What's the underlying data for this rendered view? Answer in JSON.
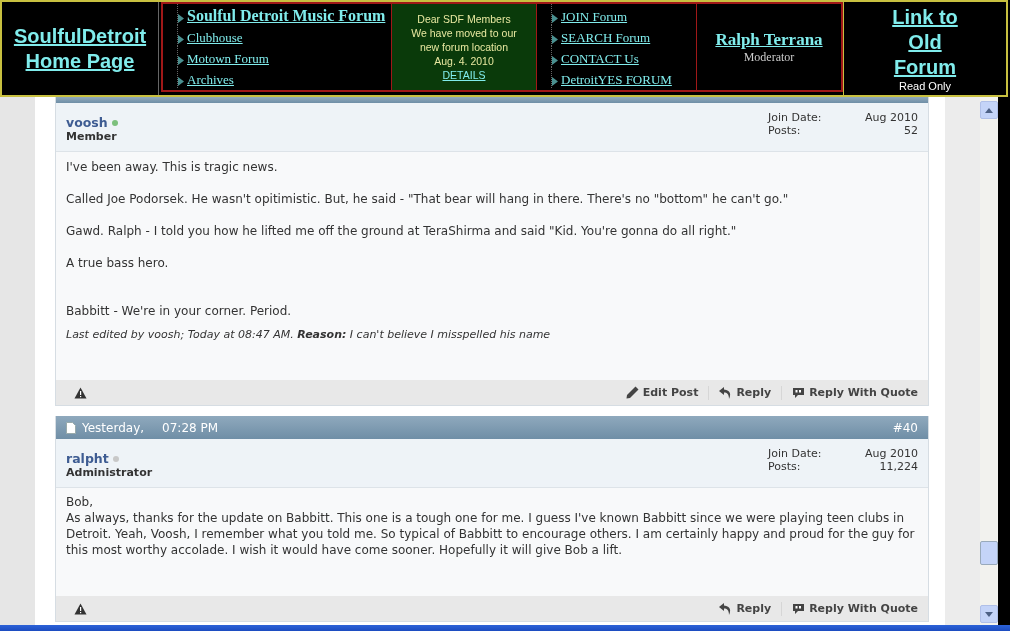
{
  "header": {
    "home_link": "SoulfulDetroit Home Page",
    "nav_links": [
      {
        "label": "Soulful Detroit Music Forum",
        "primary": true
      },
      {
        "label": "Clubhouse",
        "primary": false
      },
      {
        "label": "Motown Forum",
        "primary": false
      },
      {
        "label": "Archives",
        "primary": false
      }
    ],
    "notice": {
      "lines": [
        "Dear SDF Members",
        "We have moved to our",
        "new forum location",
        "Aug. 4. 2010"
      ],
      "link": "DETAILS"
    },
    "more_links": [
      "JOIN Forum",
      "SEARCH Forum",
      "CONTACT Us",
      "DetroitYES FORUM"
    ],
    "moderator": {
      "name": "Ralph Terrana",
      "role": "Moderator"
    },
    "old_forum": {
      "link": "Link to Old Forum",
      "note": "Read Only"
    }
  },
  "posts": [
    {
      "user": "voosh",
      "online": true,
      "rank": "Member",
      "join_label": "Join Date:",
      "join_date": "Aug 2010",
      "posts_label": "Posts:",
      "post_count": "52",
      "paragraphs": [
        "I've been away. This is tragic news.",
        "Called Joe Podorsek. He wasn't opitimistic. But, he said - \"That bear will hang in there. There's no \"bottom\" he can't go.\"",
        "Gawd. Ralph - I told you how he lifted me off the ground at TeraShirma and said \"Kid. You're gonna do all right.\"",
        "A true bass hero.",
        "Babbitt - We're in your corner. Period."
      ],
      "edit_note": "Last edited by voosh; Today at 08:47 AM. **Reason:** I can't believe I misspelled his name",
      "actions": [
        "Edit Post",
        "Reply",
        "Reply With Quote"
      ]
    },
    {
      "date": "Yesterday,",
      "time": "07:28 PM",
      "number": "#40",
      "user": "ralpht",
      "online": false,
      "rank": "Administrator",
      "join_label": "Join Date:",
      "join_date": "Aug 2010",
      "posts_label": "Posts:",
      "post_count": "11,224",
      "paragraphs": [
        "Bob,",
        "As always, thanks for the update on Babbitt. This one is a tough one for me. I guess I've known Babbitt since we were playing teen clubs in Detroit. Yeah, Voosh, I remember what you told me. So typical of Babbitt to encourage others. I am certainly happy and proud for the guy for this most worthy accolade. I wish it would have come sooner. Hopefully it will give Bob a lift."
      ],
      "actions": [
        "Reply",
        "Reply With Quote"
      ]
    }
  ]
}
